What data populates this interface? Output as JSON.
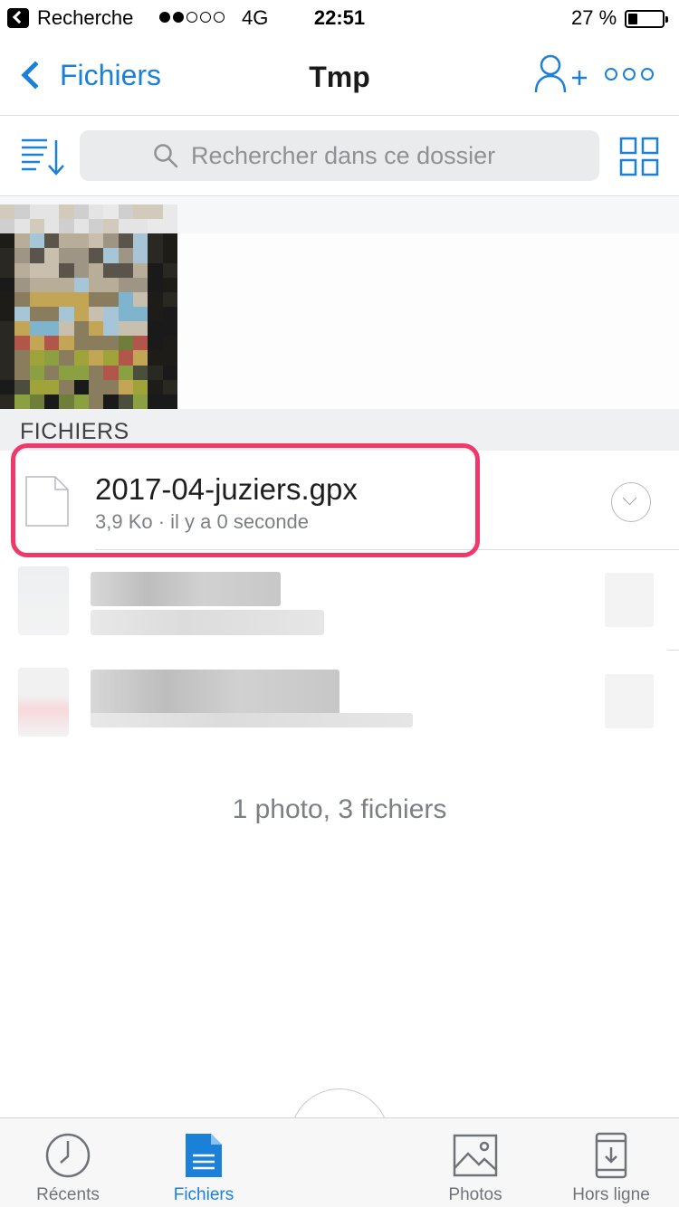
{
  "status_bar": {
    "back_label": "Recherche",
    "network": "4G",
    "time": "22:51",
    "battery": "27 %",
    "signal_bars": 2
  },
  "nav": {
    "back_label": "Fichiers",
    "title": "Tmp",
    "share_icon": "add-user-icon",
    "more_icon": "more-icon"
  },
  "toolbar": {
    "search_placeholder": "Rechercher dans ce dossier",
    "sort_icon": "sort-icon",
    "grid_icon": "grid-view-icon"
  },
  "section": {
    "title": "FICHIERS"
  },
  "files": [
    {
      "name": "2017-04-juziers.gpx",
      "meta": "3,9 Ko · il y a 0 seconde"
    }
  ],
  "summary": "1 photo, 3 fichiers",
  "tabs": [
    {
      "label": "Récents",
      "icon": "clock-icon",
      "active": false
    },
    {
      "label": "Fichiers",
      "icon": "document-icon",
      "active": true
    },
    {
      "label": "Photos",
      "icon": "photo-icon",
      "active": false
    },
    {
      "label": "Hors ligne",
      "icon": "offline-icon",
      "active": false
    }
  ],
  "colors": {
    "accent": "#1b80d8",
    "highlight": "#f0386b",
    "muted_text": "#7c8085"
  }
}
